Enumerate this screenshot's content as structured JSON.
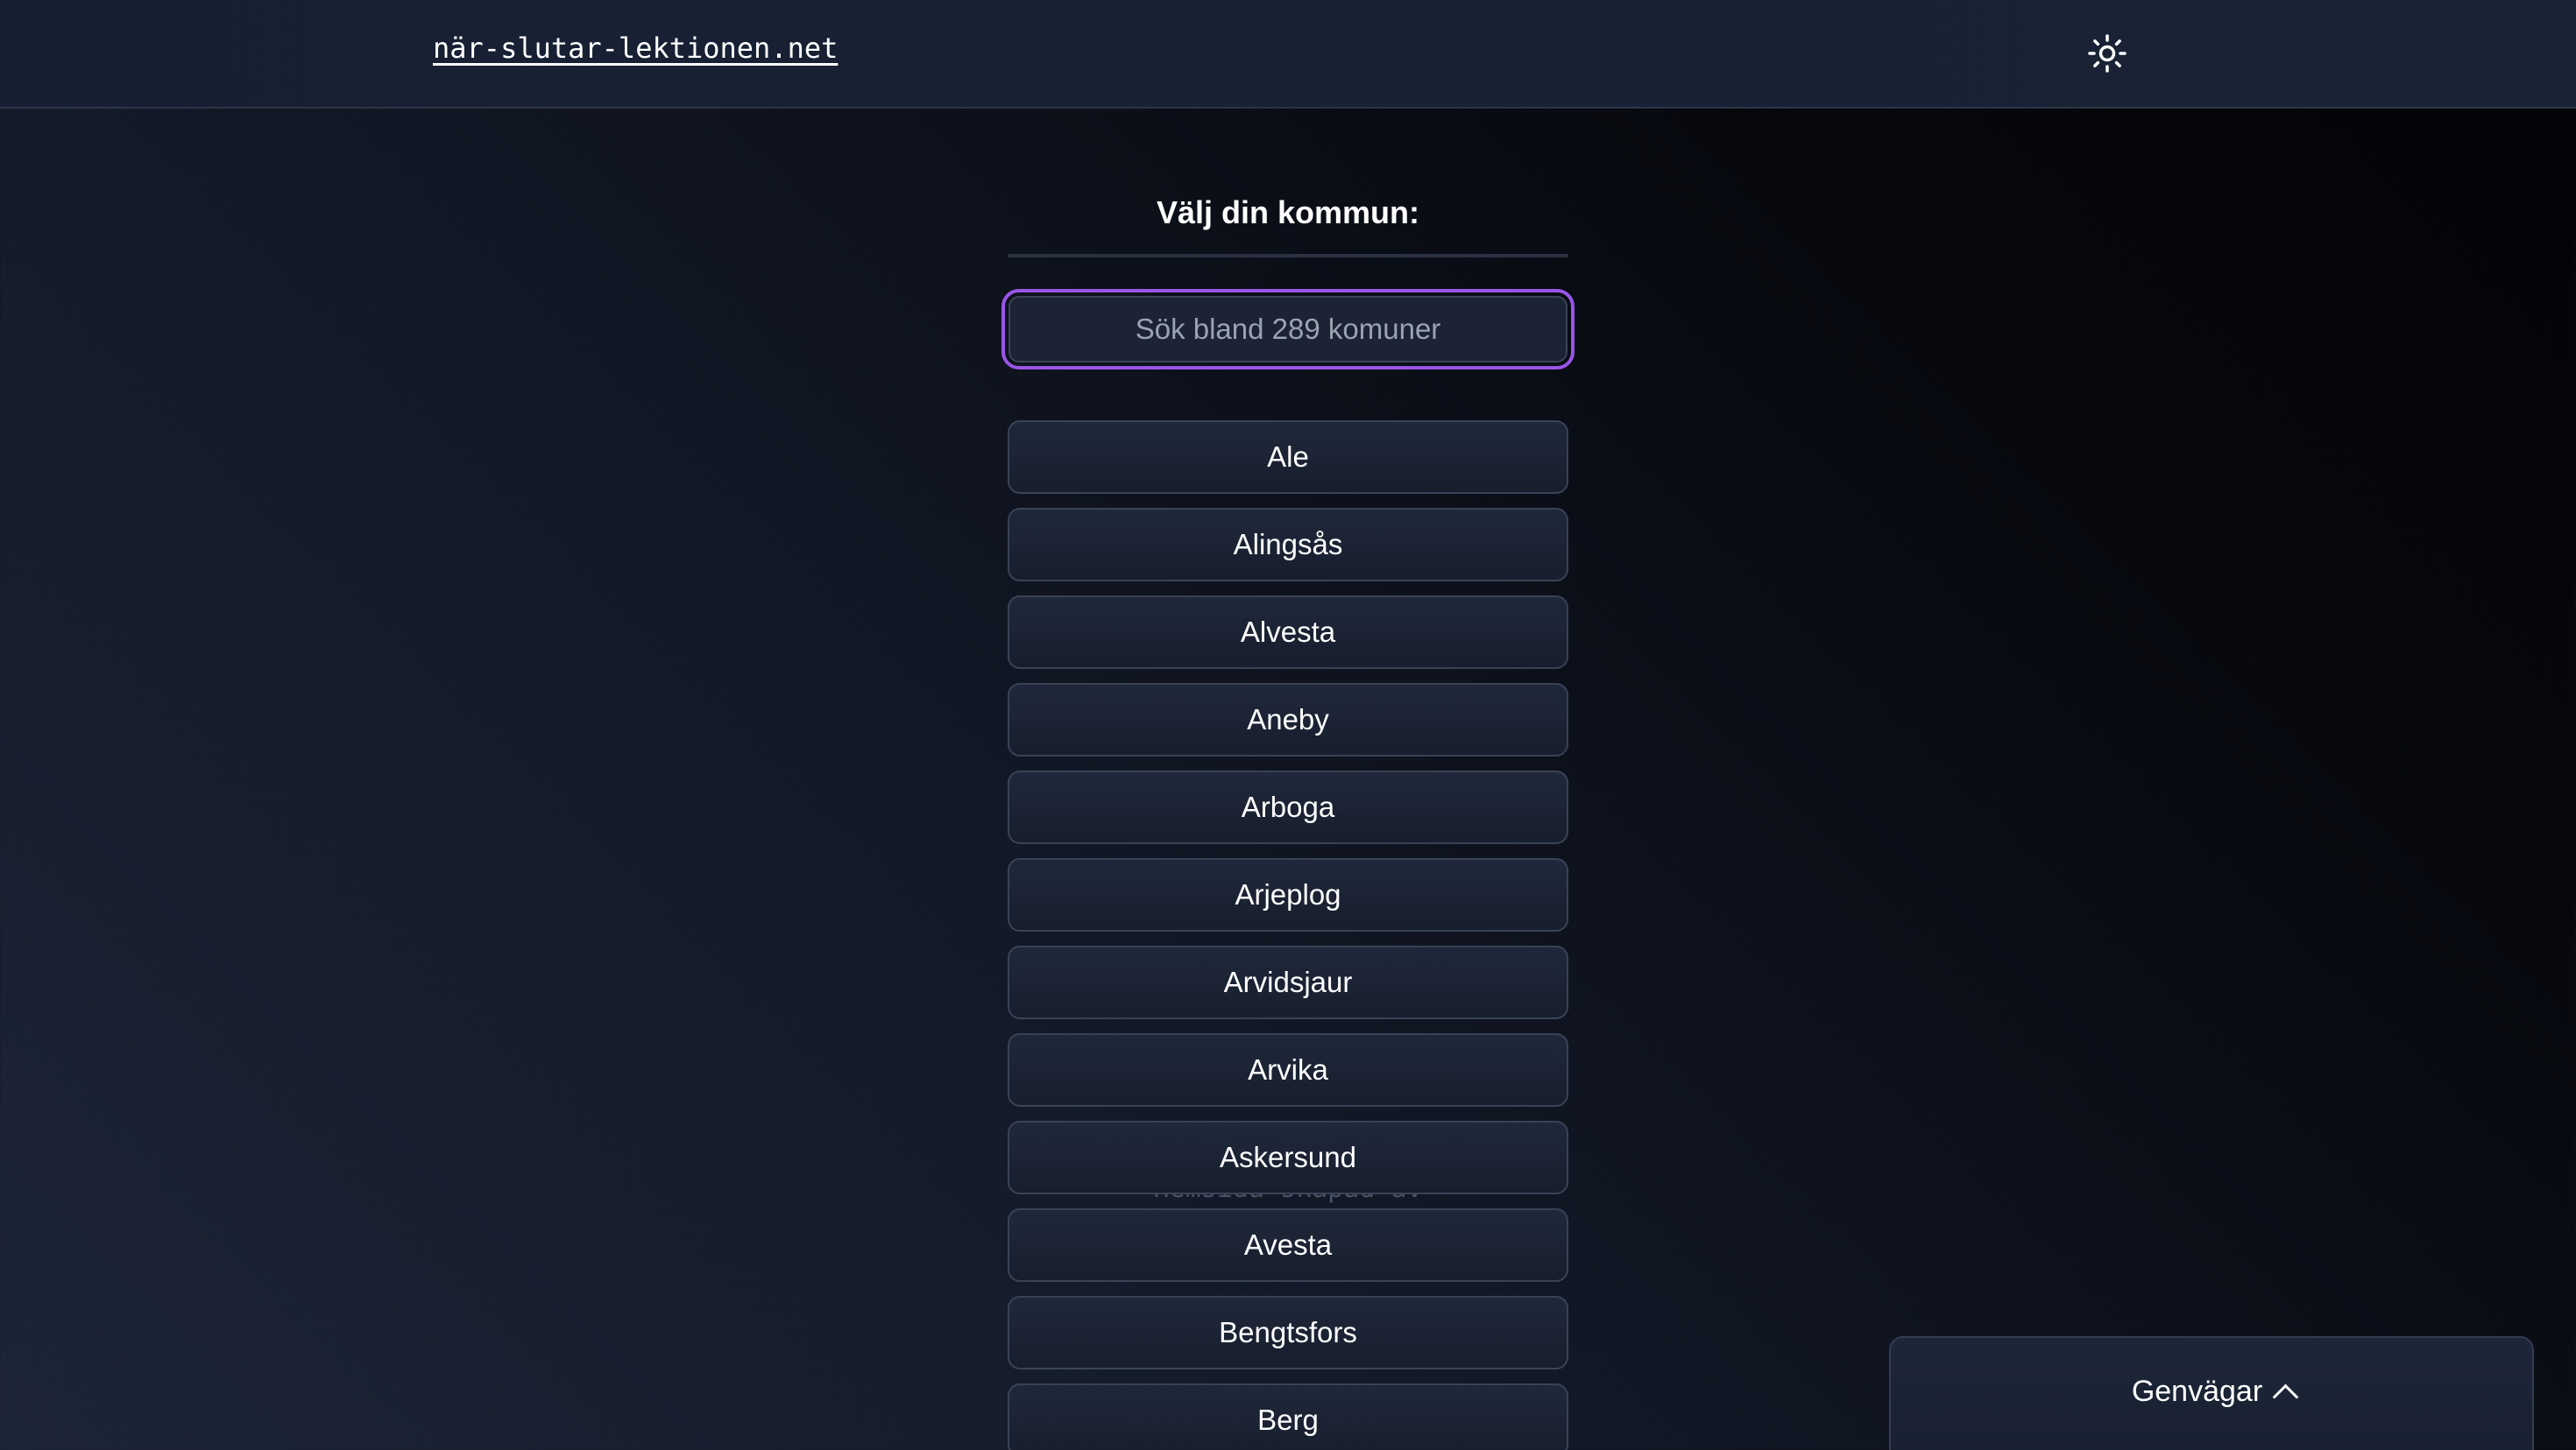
{
  "header": {
    "site_name": "när-slutar-lektionen.net",
    "theme_toggle_icon": "sun-icon"
  },
  "main": {
    "heading": "Välj din kommun:",
    "search": {
      "placeholder": "Sök bland 289 komuner",
      "value": ""
    },
    "municipalities": [
      "Ale",
      "Alingsås",
      "Alvesta",
      "Aneby",
      "Arboga",
      "Arjeplog",
      "Arvidsjaur",
      "Arvika",
      "Askersund",
      "Avesta",
      "Bengtsfors",
      "Berg"
    ],
    "footer_credit": "Hemsida skapad av"
  },
  "shortcuts": {
    "label": "Genvägar",
    "icon": "chevron-up-icon"
  },
  "colors": {
    "accent_focus": "#9a55e6",
    "text": "#ffffff",
    "button_border": "#394356"
  }
}
